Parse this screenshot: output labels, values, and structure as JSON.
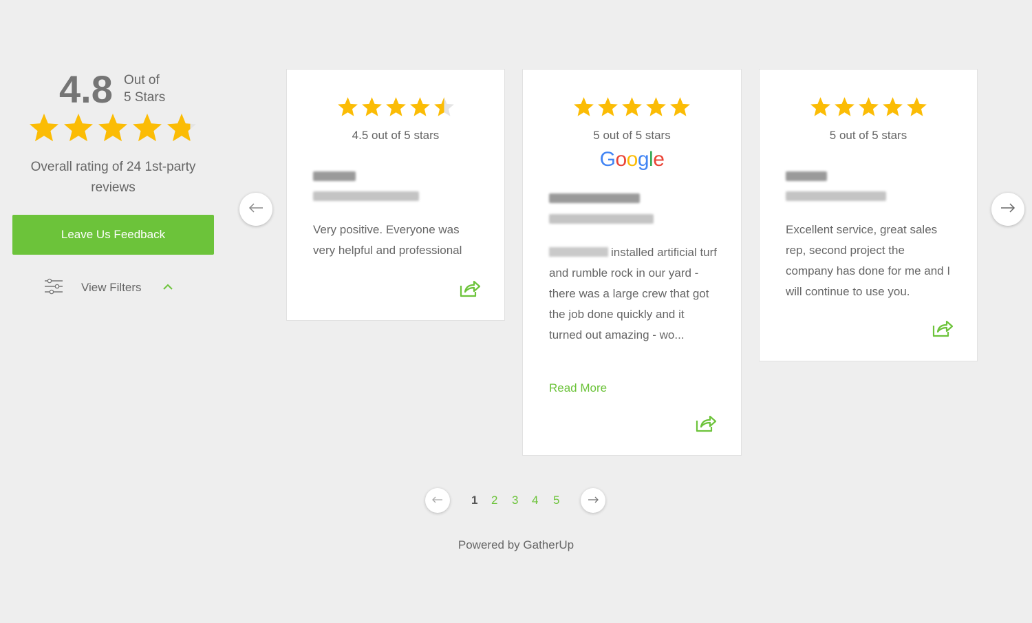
{
  "summary": {
    "score": "4.8",
    "out_of_line1": "Out of",
    "out_of_line2": "5 Stars",
    "overall_rating": 4.8,
    "overall_text": "Overall rating of 24 1st-party reviews",
    "feedback_button": "Leave Us Feedback",
    "filters_label": "View Filters"
  },
  "colors": {
    "star": "#fbbc05",
    "star_empty": "#e4e4e4",
    "accent_green": "#6cc33a",
    "background": "#eeeeee"
  },
  "reviews": [
    {
      "rating": 4.5,
      "rating_text": "4.5 out of 5 stars",
      "source": "",
      "text": "Very positive. Everyone was very helpful and professional",
      "read_more": ""
    },
    {
      "rating": 5,
      "rating_text": "5 out of 5 stars",
      "source": "Google",
      "text": "installed artificial turf and rumble rock in our yard - there was a large crew that got the job done quickly and it turned out amazing - wo...",
      "read_more": "Read More"
    },
    {
      "rating": 5,
      "rating_text": "5 out of 5 stars",
      "source": "",
      "text": "Excellent service, great sales rep, second project the company has done for me and I will continue to use you.",
      "read_more": ""
    }
  ],
  "pagination": {
    "pages": [
      "1",
      "2",
      "3",
      "4",
      "5"
    ],
    "current": "1"
  },
  "footer": {
    "powered_by": "Powered by GatherUp"
  },
  "icons": {
    "filters": "sliders-icon",
    "caret": "chevron-up-icon",
    "prev": "arrow-left-icon",
    "next": "arrow-right-icon",
    "share": "share-icon"
  }
}
